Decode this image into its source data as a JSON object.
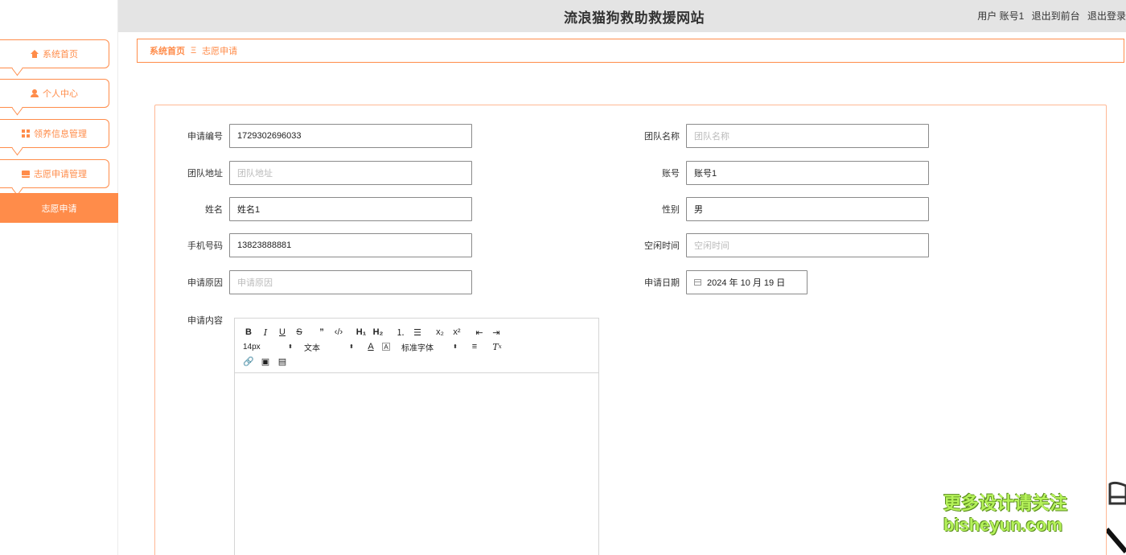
{
  "header": {
    "site_title": "流浪猫狗救助救援网站",
    "user_label": "用户 账号1",
    "to_front": "退出到前台",
    "logout": "退出登录"
  },
  "sidebar": {
    "items": [
      {
        "label": "系统首页",
        "icon": "home-icon"
      },
      {
        "label": "个人中心",
        "icon": "user-icon"
      },
      {
        "label": "领养信息管理",
        "icon": "grid-icon"
      },
      {
        "label": "志愿申请管理",
        "icon": "box-icon"
      }
    ],
    "active_sub": "志愿申请"
  },
  "breadcrumb": {
    "home": "系统首页",
    "separator": "Ξ",
    "current": "志愿申请"
  },
  "form": {
    "apply_no": {
      "label": "申请编号",
      "value": "1729302696033"
    },
    "team_name": {
      "label": "团队名称",
      "placeholder": "团队名称"
    },
    "team_address": {
      "label": "团队地址",
      "placeholder": "团队地址"
    },
    "account": {
      "label": "账号",
      "value": "账号1"
    },
    "name": {
      "label": "姓名",
      "value": "姓名1"
    },
    "gender": {
      "label": "性别",
      "value": "男"
    },
    "phone": {
      "label": "手机号码",
      "value": "13823888881"
    },
    "free_time": {
      "label": "空闲时间",
      "placeholder": "空闲时间"
    },
    "reason": {
      "label": "申请原因",
      "placeholder": "申请原因"
    },
    "date": {
      "label": "申请日期",
      "value": "2024 年 10 月 19 日"
    },
    "content": {
      "label": "申请内容"
    }
  },
  "editor": {
    "font_size": "14px",
    "text_style": "文本",
    "font_family": "标准字体",
    "h1": "H₁",
    "h2": "H₂",
    "sub": "x₂",
    "sup": "x²"
  },
  "watermark": {
    "line1": "更多设计请关注",
    "line2": "bisheyun.com"
  },
  "colors": {
    "accent": "#ff8c4a",
    "topbar_bg": "#e4e4e4",
    "watermark": "#b5f25a"
  }
}
